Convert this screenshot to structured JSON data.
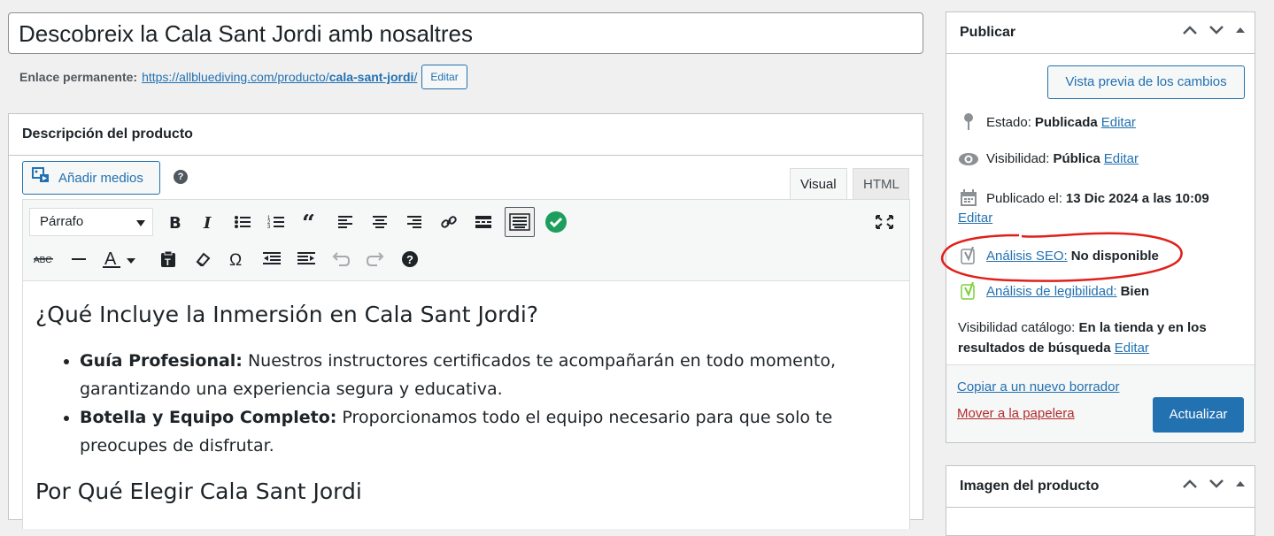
{
  "post": {
    "title": "Descobreix la Cala Sant Jordi amb nosaltres",
    "permalink_label": "Enlace permanente:",
    "permalink_base": "https://allbluediving.com/producto/",
    "permalink_slug": "cala-sant-jordi",
    "permalink_trailing": "/",
    "permalink_edit": "Editar"
  },
  "editor": {
    "box_title": "Descripción del producto",
    "add_media": "Añadir medios",
    "help": "?",
    "tab_visual": "Visual",
    "tab_html": "HTML",
    "format_select": "Párrafo",
    "icons_row1": [
      "bold-icon",
      "italic-icon",
      "bullet-list-icon",
      "numbered-list-icon",
      "blockquote-icon",
      "align-left-icon",
      "align-center-icon",
      "align-right-icon",
      "link-icon",
      "read-more-icon",
      "toolbar-toggle-icon",
      "grammar-check-icon",
      "fullscreen-icon"
    ],
    "icons_row2": [
      "strikethrough-icon",
      "horizontal-line-icon",
      "text-color-icon",
      "paste-text-icon",
      "clear-formatting-icon",
      "special-character-icon",
      "outdent-icon",
      "indent-icon",
      "undo-icon",
      "redo-icon",
      "keyboard-help-icon"
    ],
    "content": {
      "heading1": "¿Qué Incluye la Inmersión en Cala Sant Jordi?",
      "items": [
        {
          "bold": "Guía Profesional:",
          "text": " Nuestros instructores certificados te acompañarán en todo momento, garantizando una experiencia segura y educativa."
        },
        {
          "bold": "Botella y Equipo Completo:",
          "text": " Proporcionamos todo el equipo necesario para que solo te preocupes de disfrutar."
        }
      ],
      "heading2": "Por Qué Elegir Cala Sant Jordi"
    }
  },
  "publish": {
    "title": "Publicar",
    "preview": "Vista previa de los cambios",
    "status_label": "Estado:",
    "status_value": "Publicada",
    "visibility_label": "Visibilidad:",
    "visibility_value": "Pública",
    "published_label": "Publicado el:",
    "published_value": "13 Dic 2024 a las 10:09",
    "edit": "Editar",
    "seo_label": "Análisis SEO:",
    "seo_value": "No disponible",
    "readability_label": "Análisis de legibilidad:",
    "readability_value": "Bien",
    "catalog_label": "Visibilidad catálogo:",
    "catalog_value_1": "En la tienda y en los",
    "catalog_value_2": "resultados de búsqueda",
    "copy_draft": "Copiar a un nuevo borrador",
    "trash": "Mover a la papelera",
    "update": "Actualizar"
  },
  "product_image": {
    "title": "Imagen del producto"
  },
  "colors": {
    "accent": "#2271b1",
    "danger": "#b32d2e",
    "seo_good": "#7ad03a",
    "annotation": "#e0201a"
  }
}
